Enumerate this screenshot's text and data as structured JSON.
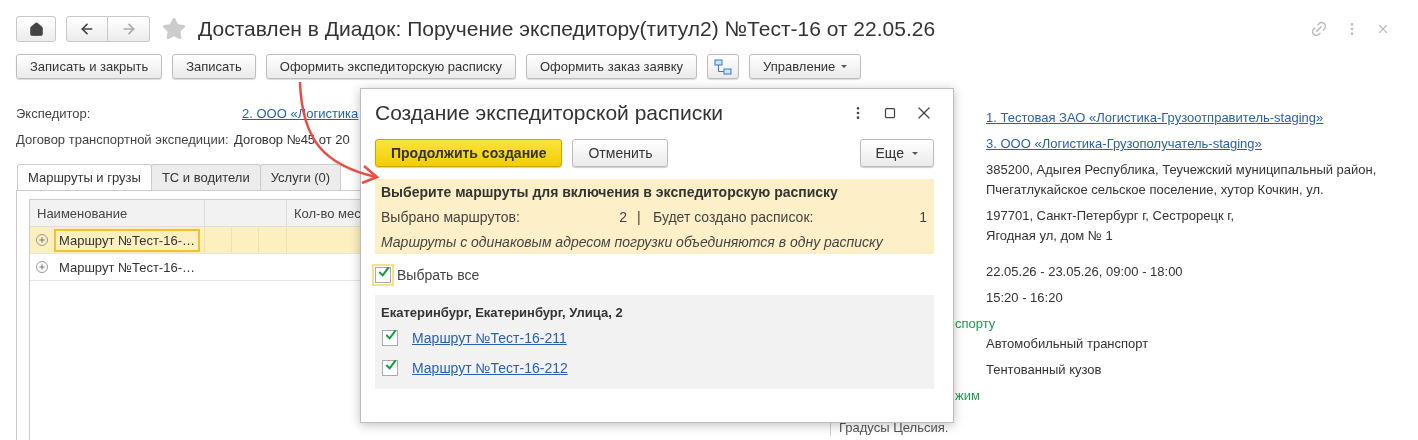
{
  "window": {
    "title": "Доставлен в Диадок: Поручение экспедитору(титул2) №Тест-16 от 22.05.26"
  },
  "toolbar": [
    {
      "kind": "text",
      "label": "Записать и закрыть"
    },
    {
      "kind": "text",
      "label": "Записать"
    },
    {
      "kind": "text",
      "label": "Оформить экспедиторскую расписку"
    },
    {
      "kind": "text",
      "label": "Оформить заказ заявку"
    },
    {
      "kind": "icon"
    },
    {
      "kind": "menu",
      "label": "Управление"
    }
  ],
  "fields": [
    {
      "kind": "link",
      "label": "Экспедитор:",
      "value": "2. ООО «Логистика"
    },
    {
      "kind": "text",
      "label": "Договор транспортной экспедиции:",
      "value": "Договор №45 от 20"
    }
  ],
  "tabs": [
    {
      "label": "Маршруты и грузы",
      "selected": true
    },
    {
      "label": "ТС и водители",
      "selected": false
    },
    {
      "label": "Услуги (0)",
      "selected": false
    }
  ],
  "table": {
    "columns": [
      "Наименование",
      "Кол-во мес"
    ],
    "rows": [
      {
        "name": "Маршрут №Тест-16-…",
        "selected": true
      },
      {
        "name": "Маршрут №Тест-16-…",
        "selected": false
      }
    ]
  },
  "details": [
    {
      "kind": "link",
      "lines": [
        "1. Тестовая ЗАО «Логистика-Грузоотправитель-staging»"
      ]
    },
    {
      "kind": "link",
      "lines": [
        "3. ООО «Логистика-Грузополучатель-staging»"
      ]
    },
    {
      "kind": "text",
      "lines": [
        "385200, Адыгея Республика, Теучежский муниципальный район,",
        "Пчегатлукайское сельское поселение, хутор Кочкин, ул."
      ]
    },
    {
      "kind": "text",
      "lines": [
        "197701, Санкт-Петербург г, Сестрорецк г,",
        "Ягодная ул, дом № 1"
      ]
    },
    {
      "kind": "period",
      "lines": [
        "22.05.26 - 23.05.26, 09:00 - 18:00"
      ]
    },
    {
      "kind": "text",
      "lines": [
        "15:20 - 16:20"
      ]
    },
    {
      "kind": "group",
      "lines": [
        "спорту"
      ]
    },
    {
      "kind": "text",
      "lines": [
        "Автомобильный транспорт"
      ]
    },
    {
      "kind": "text",
      "lines": [
        "Тентованный кузов"
      ]
    },
    {
      "kind": "group",
      "lines": [
        "жим"
      ]
    }
  ],
  "details_footer": "Градусы Цельсия.",
  "dialog": {
    "title": "Создание экспедиторской расписки",
    "buttons": [
      {
        "kind": "primary",
        "label": "Продолжить создание"
      },
      {
        "kind": "default",
        "label": "Отменить"
      },
      {
        "kind": "menu",
        "label": "Еще"
      }
    ],
    "notice": {
      "heading": "Выберите маршруты для включения в экспедиторскую расписку",
      "selected_label": "Выбрано маршрутов:",
      "selected_count": "2",
      "separator": "|",
      "receipts_label": "Будет создано расписок:",
      "receipts_count": "1",
      "hint": "Маршруты с одинаковым адресом погрузки объединяются в одну расписку"
    },
    "select_all": {
      "label": "Выбрать все",
      "checked": true
    },
    "groups": [
      {
        "address": "Екатеринбург, Екатеринбург, Улица, 2",
        "routes": [
          {
            "name": "Маршрут №Тест-16-211",
            "checked": true
          },
          {
            "name": "Маршрут №Тест-16-212",
            "checked": true
          }
        ]
      }
    ]
  }
}
